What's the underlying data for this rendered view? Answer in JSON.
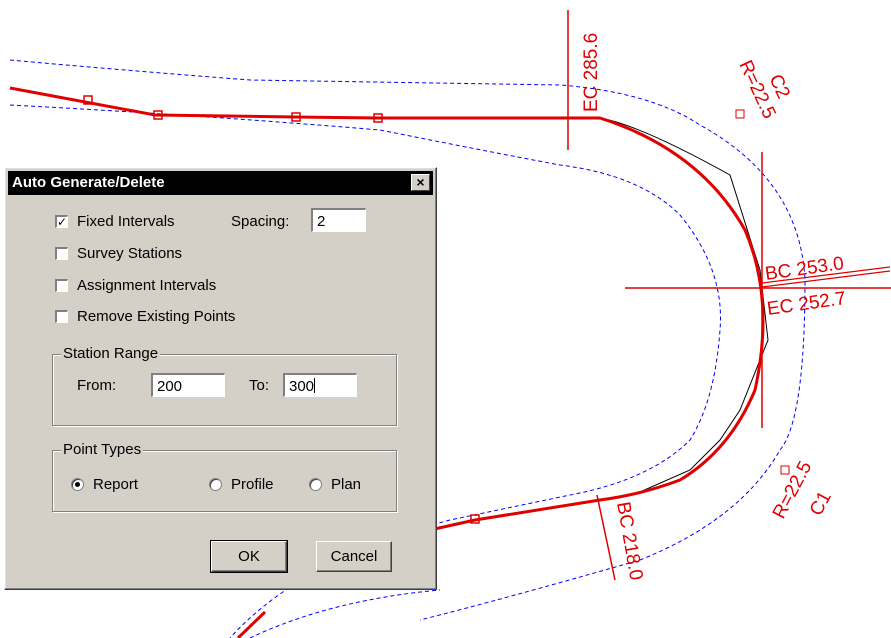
{
  "drawing": {
    "labels": {
      "ec_top": "EC 285.6",
      "c2": "C2",
      "r2": "R=22.5",
      "bc_right": "BC 253.0",
      "ec_right": "EC 252.7",
      "bc_bottom": "BC 218.0",
      "r1": "R=22.5",
      "c1": "C1"
    },
    "colors": {
      "alignment": "#e00000",
      "offset": "#0000ff",
      "original": "#000000"
    }
  },
  "dialog": {
    "title": "Auto Generate/Delete",
    "close_icon": "×",
    "options": {
      "fixed_intervals": {
        "label": "Fixed Intervals",
        "checked": true
      },
      "survey_stations": {
        "label": "Survey Stations",
        "checked": false
      },
      "assignment_intervals": {
        "label": "Assignment Intervals",
        "checked": false
      },
      "remove_existing": {
        "label": "Remove Existing Points",
        "checked": false
      }
    },
    "spacing": {
      "label": "Spacing:",
      "value": "2"
    },
    "station_range": {
      "title": "Station Range",
      "from_label": "From:",
      "from_value": "200",
      "to_label": "To:",
      "to_value": "300"
    },
    "point_types": {
      "title": "Point Types",
      "selected": "Report",
      "options": [
        "Report",
        "Profile",
        "Plan"
      ]
    },
    "buttons": {
      "ok": "OK",
      "cancel": "Cancel"
    }
  }
}
